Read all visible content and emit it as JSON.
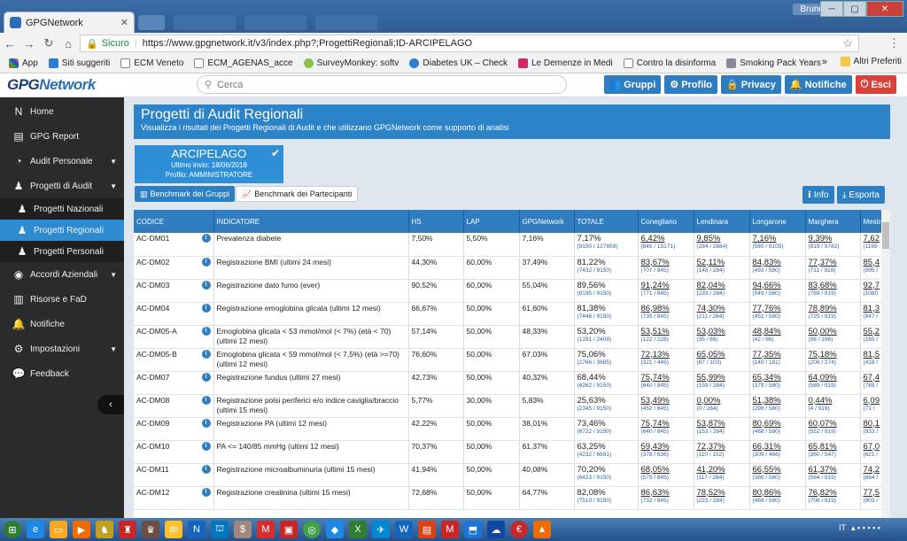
{
  "browser": {
    "tab_title": "GPGNetwork",
    "user": "Bruno",
    "secure_label": "Sicuro",
    "url": "https://www.gpgnetwork.it/v3/index.php?;ProgettiRegionali;ID-ARCIPELAGO",
    "bookmarks": [
      "App",
      "Siti suggeriti",
      "ECM Veneto",
      "ECM_AGENAS_acce",
      "SurveyMonkey: softv",
      "Diabetes UK – Check",
      "Le Demenze in Medi",
      "Contro la disinforma",
      "Smoking Pack Years"
    ],
    "bookmarks_more": "»",
    "other_bookmarks": "Altri Preferiti"
  },
  "app": {
    "logo_a": "GPG",
    "logo_b": "Network",
    "search_placeholder": "Cerca",
    "top_buttons": [
      "Gruppi",
      "Profilo",
      "Privacy",
      "Notifiche"
    ],
    "exit": "Esci"
  },
  "sidebar": {
    "items": [
      "Home",
      "GPG Report",
      "Audit Personale",
      "Progetti di Audit",
      "Progetti Nazionali",
      "Progetti Regionali",
      "Progetti Personali",
      "Accordi Aziendali",
      "Risorse e FaD",
      "Notifiche",
      "Impostazioni",
      "Feedback"
    ]
  },
  "page": {
    "title": "Progetti di Audit Regionali",
    "subtitle": "Visualizza i risultati dei Progetti Regionali di Audit e che utilizzano GPGNetwork come supporto di analisi",
    "card_title": "ARCIPELAGO",
    "card_last": "Ultimo invio: 18/06/2018",
    "card_profile": "Profilo: AMMINISTRATORE",
    "tab_groups": "Benchmark dei Gruppi",
    "tab_participants": "Benchmark dei Partecipanti",
    "info": "Info",
    "export": "Esporta"
  },
  "table": {
    "headers": [
      "CODICE",
      "INDICATORE",
      "HS",
      "LAP",
      "GPGNetwork",
      "TOTALE",
      "Conegliano",
      "Lendinara",
      "Longarone",
      "Marghera",
      "Mestre"
    ],
    "rows": [
      {
        "code": "AC-DM01",
        "ind": "Prevalenza diabete",
        "hs": "7,50%",
        "lap": "5,50%",
        "gpg": "7,16%",
        "cells": [
          [
            "7,17%",
            "(9150 / 127659)"
          ],
          [
            "6,42%",
            "(845 / 13171)"
          ],
          [
            "9,85%",
            "(284 / 2884)"
          ],
          [
            "7,16%",
            "(580 / 8105)"
          ],
          [
            "9,39%",
            "(919 / 9782)"
          ],
          [
            "7,62",
            "(1165"
          ]
        ]
      },
      {
        "code": "AC-DM02",
        "ind": "Registrazione BMI (ultimi 24 mesi)",
        "hs": "44,30%",
        "lap": "60,00%",
        "gpg": "37,49%",
        "cells": [
          [
            "81,22%",
            "(7432 / 9150)"
          ],
          [
            "83,67%",
            "(707 / 845)"
          ],
          [
            "52,11%",
            "(148 / 284)"
          ],
          [
            "84,83%",
            "(492 / 580)"
          ],
          [
            "77,37%",
            "(711 / 919)"
          ],
          [
            "85,4",
            "(995 /"
          ]
        ]
      },
      {
        "code": "AC-DM03",
        "ind": "Registrazione dato fumo (ever)",
        "hs": "90,52%",
        "lap": "60,00%",
        "gpg": "55,04%",
        "cells": [
          [
            "89,56%",
            "(8195 / 9150)"
          ],
          [
            "91,24%",
            "(771 / 845)"
          ],
          [
            "82,04%",
            "(233 / 284)"
          ],
          [
            "94,66%",
            "(549 / 580)"
          ],
          [
            "83,68%",
            "(769 / 919)"
          ],
          [
            "92,7",
            "(1080"
          ]
        ]
      },
      {
        "code": "AC-DM04",
        "ind": "Registrazione emoglobina glicata (ultimi 12 mesi)",
        "hs": "66,67%",
        "lap": "50,00%",
        "gpg": "61,60%",
        "cells": [
          [
            "81,38%",
            "(7446 / 9150)"
          ],
          [
            "86,98%",
            "(735 / 845)"
          ],
          [
            "74,30%",
            "(211 / 284)"
          ],
          [
            "77,76%",
            "(451 / 580)"
          ],
          [
            "78,89%",
            "(725 / 919)"
          ],
          [
            "81,3",
            "(947 /"
          ]
        ]
      },
      {
        "code": "AC-DM05-A",
        "ind": "Emoglobina glicata < 53 mmol/mol (< 7%) (età < 70) (ultimi 12 mesi)",
        "hs": "57,14%",
        "lap": "50,00%",
        "gpg": "48,33%",
        "cells": [
          [
            "53,20%",
            "(1281 / 2408)"
          ],
          [
            "53,51%",
            "(122 / 228)"
          ],
          [
            "53,03%",
            "(35 / 66)"
          ],
          [
            "48,84%",
            "(42 / 86)"
          ],
          [
            "50,00%",
            "(98 / 196)"
          ],
          [
            "55,2",
            "(165 /"
          ]
        ]
      },
      {
        "code": "AC-DM05-B",
        "ind": "Emoglobina glicata < 59 mmol/mol (< 7,5%) (età >=70) (ultimi 12 mesi)",
        "hs": "76,60%",
        "lap": "50,00%",
        "gpg": "67,03%",
        "cells": [
          [
            "75,06%",
            "(2766 / 3685)"
          ],
          [
            "72,13%",
            "(321 / 445)"
          ],
          [
            "65,05%",
            "(67 / 103)"
          ],
          [
            "77,35%",
            "(140 / 181)"
          ],
          [
            "75,18%",
            "(206 / 274)"
          ],
          [
            "81,5",
            "(418 /"
          ]
        ]
      },
      {
        "code": "AC-DM07",
        "ind": "Registrazione fundus (ultimi 27 mesi)",
        "hs": "42,73%",
        "lap": "50,00%",
        "gpg": "40,32%",
        "cells": [
          [
            "68,44%",
            "(6262 / 9150)"
          ],
          [
            "75,74%",
            "(640 / 845)"
          ],
          [
            "55,99%",
            "(159 / 284)"
          ],
          [
            "65,34%",
            "(379 / 580)"
          ],
          [
            "64,09%",
            "(589 / 919)"
          ],
          [
            "67,4",
            "(785 /"
          ]
        ]
      },
      {
        "code": "AC-DM08",
        "ind": "Registrazione polsi periferici e/o indice caviglia/braccio (ultimi 15 mesi)",
        "hs": "5,77%",
        "lap": "30,00%",
        "gpg": "5,83%",
        "cells": [
          [
            "25,63%",
            "(2345 / 9150)"
          ],
          [
            "53,49%",
            "(452 / 845)"
          ],
          [
            "0,00%",
            "(0 / 284)"
          ],
          [
            "51,38%",
            "(298 / 580)"
          ],
          [
            "0,44%",
            "(4 / 919)"
          ],
          [
            "6,09",
            "(71 /"
          ]
        ]
      },
      {
        "code": "AC-DM09",
        "ind": "Registrazione PA (ultimi 12 mesi)",
        "hs": "42,22%",
        "lap": "50,00%",
        "gpg": "38,01%",
        "cells": [
          [
            "73,46%",
            "(6722 / 9150)"
          ],
          [
            "75,74%",
            "(640 / 845)"
          ],
          [
            "53,87%",
            "(153 / 284)"
          ],
          [
            "80,69%",
            "(468 / 580)"
          ],
          [
            "60,07%",
            "(552 / 919)"
          ],
          [
            "80,1",
            "(933 /"
          ]
        ]
      },
      {
        "code": "AC-DM10",
        "ind": "PA <= 140/85 mmHg (ultimi 12 mesi)",
        "hs": "70,37%",
        "lap": "50,00%",
        "gpg": "61,37%",
        "cells": [
          [
            "63,25%",
            "(4232 / 6691)"
          ],
          [
            "59,43%",
            "(378 / 636)"
          ],
          [
            "72,37%",
            "(110 / 152)"
          ],
          [
            "66,31%",
            "(309 / 466)"
          ],
          [
            "65,81%",
            "(360 / 547)"
          ],
          [
            "67,0",
            "(621 /"
          ]
        ]
      },
      {
        "code": "AC-DM11",
        "ind": "Registrazione microalbuminuria (ultimi 15 mesi)",
        "hs": "41,94%",
        "lap": "50,00%",
        "gpg": "40,08%",
        "cells": [
          [
            "70,20%",
            "(6423 / 9150)"
          ],
          [
            "68,05%",
            "(575 / 845)"
          ],
          [
            "41,20%",
            "(117 / 284)"
          ],
          [
            "66,55%",
            "(386 / 580)"
          ],
          [
            "61,37%",
            "(564 / 919)"
          ],
          [
            "74,2",
            "(864 /"
          ]
        ]
      },
      {
        "code": "AC-DM12",
        "ind": "Registrazione creatinina (ultimi 15 mesi)",
        "hs": "72,68%",
        "lap": "50,00%",
        "gpg": "64,77%",
        "cells": [
          [
            "82,08%",
            "(7510 / 9150)"
          ],
          [
            "86,63%",
            "(732 / 845)"
          ],
          [
            "78,52%",
            "(223 / 284)"
          ],
          [
            "80,86%",
            "(469 / 580)"
          ],
          [
            "76,82%",
            "(706 / 919)"
          ],
          [
            "77,5",
            "(903 /"
          ]
        ]
      }
    ]
  }
}
